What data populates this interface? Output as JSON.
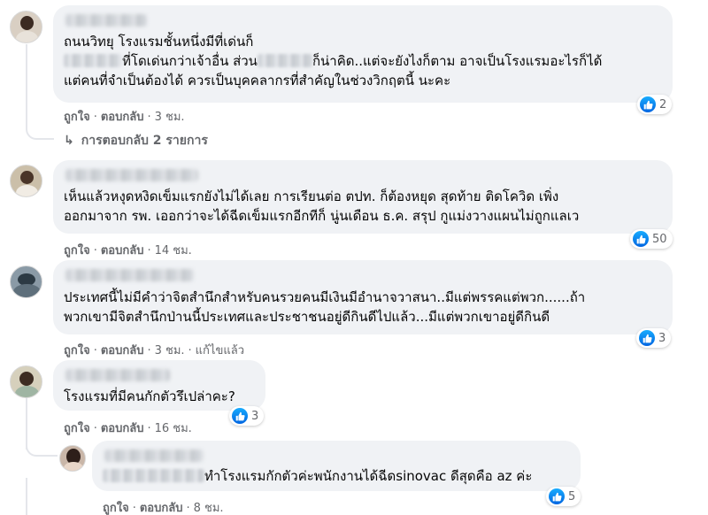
{
  "comments": [
    {
      "line1": "ถนนวิทยุ โรงแรมชั้นหนึ่งมีที่เด่นก็",
      "line2a": "ที่โดเด่นกว่าเจ้าอื่น ส่วน",
      "line2b": "ก็น่าคิด..แต่จะยังไงก็ตาม อาจเป็นโรงแรมอะไรก็ได้",
      "line3": "แต่คนที่จำเป็นต้องได้ ควรเป็นบุคคลากรที่สำคัญในช่วงวิกฤตนี้ นะคะ",
      "like": "ถูกใจ",
      "reply": "ตอบกลับ",
      "time": "3 ชม.",
      "reactions": "2",
      "replies_label": "การตอบกลับ 2 รายการ"
    },
    {
      "line1": "เห็นแล้วหงุดหงิดเข็มแรกยังไม่ได้เลย การเรียนต่อ ตปท. ก็ต้องหยุด สุดท้าย ติดโควิด เพิ่ง",
      "line2": "ออกมาจาก รพ. เออกว่าจะได้ฉีดเข็มแรกอีกทีก็ นู่นเดือน ธ.ค. สรุป กูแม่งวางแผนไม่ถูกแลเว",
      "like": "ถูกใจ",
      "reply": "ตอบกลับ",
      "time": "14 ชม.",
      "reactions": "50"
    },
    {
      "line1": "ประเทศนี้ไม่มีคำว่าจิตสำนึกสำหรับคนรวยคนมีเงินมีอำนาจวาสนา..มีแต่พรรคแต่พวก......ถ้า",
      "line2": "พวกเขามีจิตสำนึกป่านนี้ประเทศและประชาชนอยู่ดีกินดีไปแล้ว...มีแต่พวกเขาอยู่ดีกินดี",
      "like": "ถูกใจ",
      "reply": "ตอบกลับ",
      "time": "3 ชม.",
      "edited": "แก้ไขแล้ว",
      "reactions": "3"
    },
    {
      "line1": "โรงแรมที่มีคนกักตัวรึเปล่าคะ?",
      "like": "ถูกใจ",
      "reply": "ตอบกลับ",
      "time": "16 ชม.",
      "reactions": "3"
    },
    {
      "line1": "ทำโรงแรมกักตัวค่ะพนักงานได้ฉีดsinovac ดีสุดคือ az ค่ะ",
      "like": "ถูกใจ",
      "reply": "ตอบกลับ",
      "time": "8 ชม.",
      "reactions": "5"
    }
  ],
  "separator": "·",
  "icons": {
    "like": "thumbs-up-icon",
    "reply_arrow": "reply-arrow-icon"
  },
  "colors": {
    "bubble": "#f0f2f5",
    "meta_text": "#65676b",
    "like_blue": "#0866ff"
  }
}
